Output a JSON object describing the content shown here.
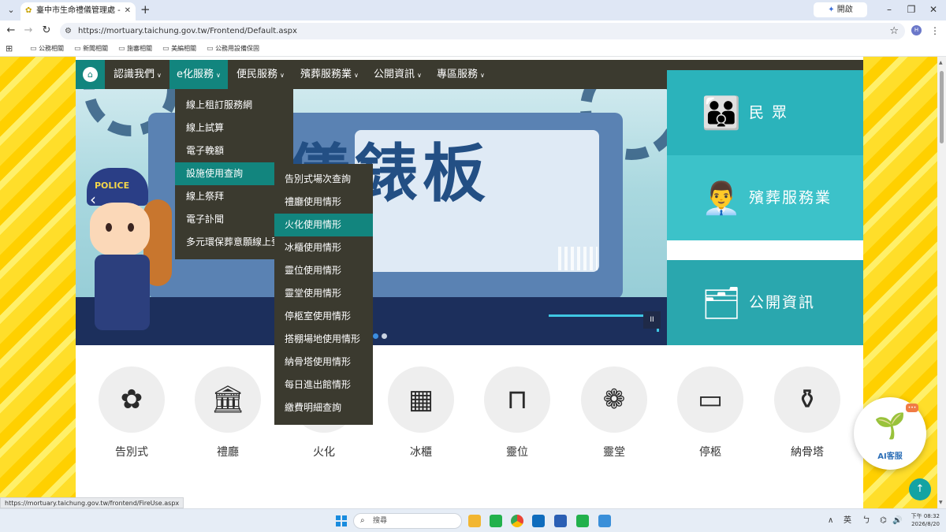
{
  "browser": {
    "tab_title": "臺中市生命禮儀管理處 - 殯葬資",
    "new_tab": "+",
    "gemini_label": "開啟 Gemini",
    "url": "https://mortuary.taichung.gov.tw/Frontend/Default.aspx",
    "profile_initial": "H",
    "bookmarks": [
      "公務相關",
      "新聞相關",
      "施審相關",
      "美編相關",
      "公務用設備保固"
    ]
  },
  "nav": {
    "items": [
      {
        "label": "認識我們"
      },
      {
        "label": "e化服務"
      },
      {
        "label": "便民服務"
      },
      {
        "label": "殯葬服務業"
      },
      {
        "label": "公開資訊"
      },
      {
        "label": "專區服務"
      }
    ]
  },
  "dropdown": {
    "items": [
      "線上租訂服務網",
      "線上試算",
      "電子輓額",
      "設施使用查詢",
      "線上祭拜",
      "電子訃聞",
      "多元環保葬意願線上登"
    ],
    "active_index": 3
  },
  "submenu": {
    "items": [
      "告別式場次查詢",
      "禮廳使用情形",
      "火化使用情形",
      "冰櫃使用情形",
      "靈位使用情形",
      "靈堂使用情形",
      "停柩室使用情形",
      "搭棚場地使用情形",
      "納骨塔使用情形",
      "每日進出館情形",
      "繳費明細查詢"
    ],
    "active_index": 2
  },
  "banner": {
    "title": "儀錶板",
    "cap_text": "POLICE",
    "pause": "II"
  },
  "audience_tiles": [
    {
      "label": "民 眾",
      "icon": "family-icon",
      "color": "#2bb3bb"
    },
    {
      "label": "殯葬服務業",
      "icon": "worker-icon",
      "color": "#3cc2c9"
    },
    {
      "label": "公開資訊",
      "icon": "board-icon",
      "color": "#2aa7ae"
    }
  ],
  "services": [
    {
      "label": "告別式",
      "icon": "flower-icon"
    },
    {
      "label": "禮廳",
      "icon": "hall-icon"
    },
    {
      "label": "火化",
      "icon": "flame-icon"
    },
    {
      "label": "冰櫃",
      "icon": "freezer-icon"
    },
    {
      "label": "靈位",
      "icon": "tablet-icon"
    },
    {
      "label": "靈堂",
      "icon": "wreath-icon"
    },
    {
      "label": "停柩",
      "icon": "coffin-icon"
    },
    {
      "label": "納骨塔",
      "icon": "urn-icon"
    }
  ],
  "ai_bot": {
    "label": "AI客服"
  },
  "status_url": "https://mortuary.taichung.gov.tw/frontend/FireUse.aspx",
  "taskbar": {
    "search_placeholder": "搜尋",
    "ime": "英",
    "time": "下午 08:32",
    "date": "2026/8/20"
  },
  "colors": {
    "nav_bg": "#3b3a2f",
    "accent_teal": "#12857e",
    "page_yellow": "#ffd81f"
  }
}
